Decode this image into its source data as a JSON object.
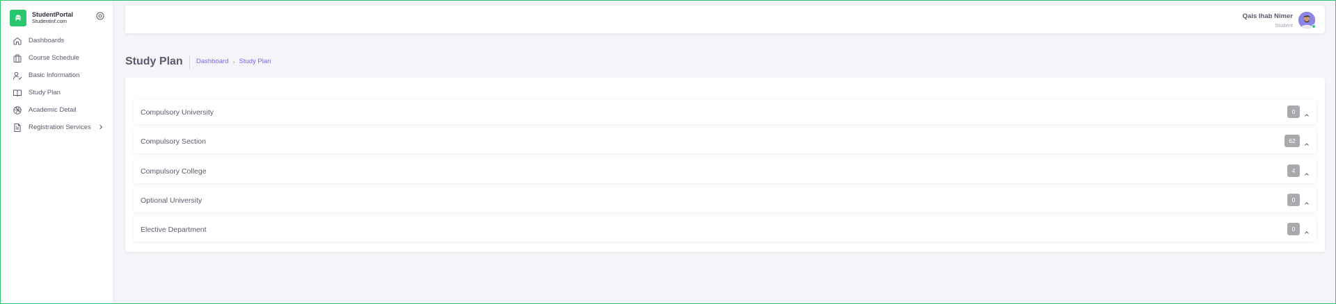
{
  "brand": {
    "title": "StudentPortal",
    "subtitle": "Studentinf.com",
    "logo_icon": "student-logo-icon",
    "accent_color": "#28c76f"
  },
  "sidebar": {
    "items": [
      {
        "label": "Dashboards",
        "icon": "home-icon"
      },
      {
        "label": "Course Schedule",
        "icon": "building-icon"
      },
      {
        "label": "Basic Information",
        "icon": "user-check-icon"
      },
      {
        "label": "Study Plan",
        "icon": "book-icon"
      },
      {
        "label": "Academic Detail",
        "icon": "aperture-icon"
      },
      {
        "label": "Registration Services",
        "icon": "file-text-icon",
        "has_submenu": true
      }
    ]
  },
  "header": {
    "user_name": "Qais Ihab Nimer",
    "user_role": "Student",
    "status_color": "#28c76f"
  },
  "page": {
    "title": "Study Plan",
    "breadcrumb": {
      "link": "Dashboard",
      "current": "Study Plan"
    }
  },
  "accordion": {
    "items": [
      {
        "label": "Compulsory University",
        "count": "0"
      },
      {
        "label": "Compulsory Section",
        "count": "62"
      },
      {
        "label": "Compulsory College",
        "count": "4"
      },
      {
        "label": "Optional University",
        "count": "0"
      },
      {
        "label": "Elective Department",
        "count": "0"
      }
    ]
  },
  "colors": {
    "primary": "#7367f0",
    "badge": "#a8aaae",
    "background": "#f5f5f9"
  }
}
